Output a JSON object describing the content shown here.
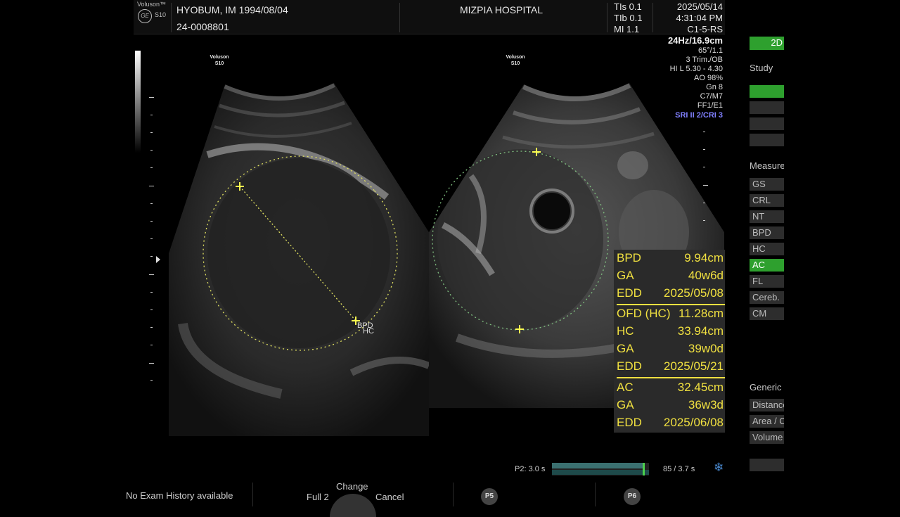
{
  "header": {
    "brand": "Voluson™",
    "logo_mark": "GE",
    "model": "S10",
    "patient": "HYOBUM, IM  1994/08/04",
    "patient_id": "24-0008801",
    "hospital": "MIZPIA HOSPITAL",
    "tis": "TIs  0.1",
    "tib": "TIb  0.1",
    "mi": "MI  1.1",
    "date": "2025/05/14",
    "time": "4:31:04 PM",
    "probe": "C1-5-RS"
  },
  "params": [
    "24Hz/16.9cm",
    "65°/1.1",
    "3 Trim./OB",
    "HI L  5.30 - 4.30",
    "AO 98%",
    "Gn  8",
    "C7/M7",
    "FF1/E1",
    "SRI II 2/CRI 3"
  ],
  "image_labels": {
    "left": "Voluson\nS10",
    "right": "Voluson\nS10"
  },
  "caliper_labels": {
    "bpd": "BPD",
    "hc": "HC"
  },
  "measurements": [
    {
      "label": "BPD",
      "value": "9.94cm"
    },
    {
      "label": "GA",
      "value": "40w6d"
    },
    {
      "label": "EDD",
      "value": "2025/05/08"
    },
    {
      "label": "OFD (HC)",
      "value": "11.28cm"
    },
    {
      "label": "HC",
      "value": "33.94cm"
    },
    {
      "label": "GA",
      "value": "39w0d"
    },
    {
      "label": "EDD",
      "value": "2025/05/21"
    },
    {
      "label": "AC",
      "value": "32.45cm"
    },
    {
      "label": "GA",
      "value": "36w3d"
    },
    {
      "label": "EDD",
      "value": "2025/06/08"
    }
  ],
  "right_panel": {
    "mode_button": "2D",
    "study_label": "Study",
    "measure_label": "Measure",
    "measure_items": [
      "GS",
      "CRL",
      "NT",
      "BPD",
      "HC",
      "AC",
      "FL",
      "Cereb.",
      "CM"
    ],
    "active_item": "AC",
    "generic_label": "Generic",
    "generic_items": [
      "Distance",
      "Area / Circ.",
      "Volume"
    ]
  },
  "cine": {
    "p2": "P2:  3.0 s",
    "counter": "85 / 3.7 s",
    "progress": 0.96
  },
  "bottom": {
    "exam_history": "No Exam History available",
    "change": "Change",
    "full": "Full 2",
    "cancel": "Cancel",
    "p5": "P5",
    "p6": "P6"
  },
  "colors": {
    "accent_green": "#2ea02e",
    "measure_yellow": "#f0e040",
    "sri_blue": "#8080ff"
  }
}
